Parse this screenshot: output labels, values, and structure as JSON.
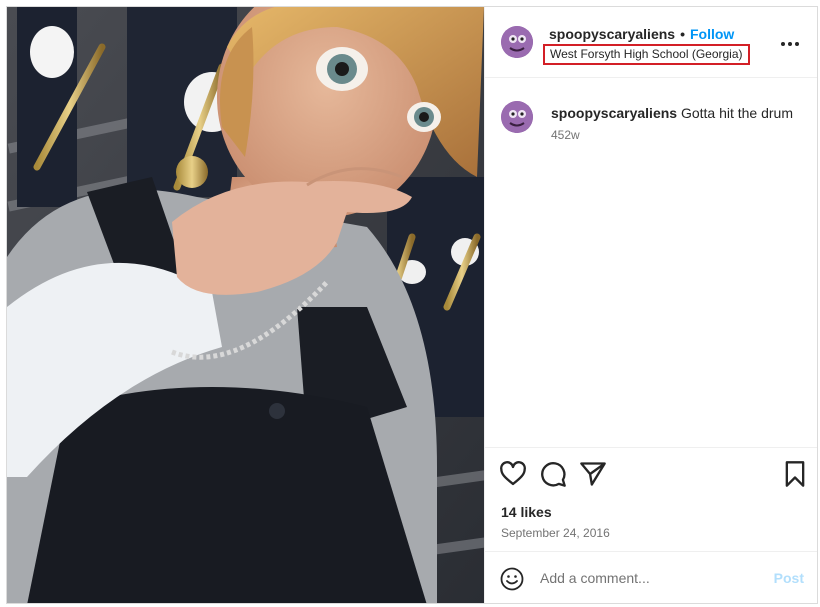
{
  "post": {
    "username": "spoopyscaryaliens",
    "separator": "•",
    "follow_label": "Follow",
    "location": "West Forsyth High School (Georgia)",
    "caption_username": "spoopyscaryaliens",
    "caption_text": "Gotta hit the drum",
    "caption_age": "452w",
    "likes": "14 likes",
    "date": "September 24, 2016"
  },
  "comment": {
    "placeholder": "Add a comment...",
    "post_label": "Post"
  },
  "icons": {
    "more": "more-horizontal-icon",
    "like": "heart-icon",
    "comment": "comment-bubble-icon",
    "share": "paper-plane-icon",
    "save": "bookmark-icon",
    "emoji": "smiley-icon"
  },
  "colors": {
    "follow": "#0095f6",
    "location_highlight": "#d31f26",
    "post_disabled": "#b2dffc",
    "muted_text": "#737373"
  }
}
